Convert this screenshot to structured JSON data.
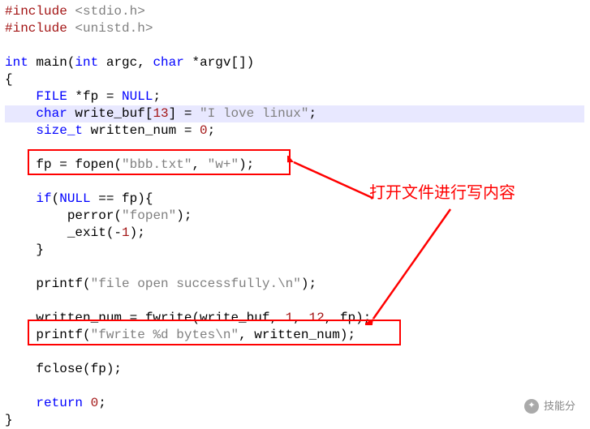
{
  "code": {
    "l1_pp": "#include",
    "l1_hdr": " <stdio.h>",
    "l2_pp": "#include",
    "l2_hdr": " <unistd.h>",
    "l4_kw1": "int",
    "l4_id1": " main(",
    "l4_kw2": "int",
    "l4_id2": " argc, ",
    "l4_kw3": "char",
    "l4_id3": " *argv[])",
    "l5": "{",
    "l6_sp": "    ",
    "l6_kw": "FILE",
    "l6_id": " *fp = ",
    "l6_kw2": "NULL",
    "l6_sc": ";",
    "l7_sp": "    ",
    "l7_kw": "char",
    "l7_id": " write_buf[",
    "l7_num": "13",
    "l7_id2": "] = ",
    "l7_str": "\"I love linux\"",
    "l7_sc": ";",
    "l8_sp": "    ",
    "l8_kw": "size_t",
    "l8_id": " written_num = ",
    "l8_num": "0",
    "l8_sc": ";",
    "l10_sp": "    ",
    "l10_id": "fp = fopen(",
    "l10_str": "\"bbb.txt\"",
    "l10_c": ", ",
    "l10_str2": "\"w+\"",
    "l10_sc": ");",
    "l12_sp": "    ",
    "l12_kw": "if",
    "l12_id": "(",
    "l12_kw2": "NULL",
    "l12_id2": " == fp){",
    "l13_sp": "        ",
    "l13_id": "perror(",
    "l13_str": "\"fopen\"",
    "l13_sc": ");",
    "l14_sp": "        ",
    "l14_id": "_exit(-",
    "l14_num": "1",
    "l14_sc": ");",
    "l15_sp": "    ",
    "l15_id": "}",
    "l17_sp": "    ",
    "l17_id": "printf(",
    "l17_str": "\"file open successfully.\\n\"",
    "l17_sc": ");",
    "l19_sp": "    ",
    "l19_id": "written_num = fwrite(write_buf, ",
    "l19_n1": "1",
    "l19_c": ", ",
    "l19_n2": "12",
    "l19_sc": ", fp);",
    "l20_sp": "    ",
    "l20_id": "printf(",
    "l20_str": "\"fwrite %d bytes\\n\"",
    "l20_id2": ", written_num);",
    "l22_sp": "    ",
    "l22_id": "fclose(fp);",
    "l24_sp": "    ",
    "l24_kw": "return",
    "l24_sp2": " ",
    "l24_num": "0",
    "l24_sc": ";",
    "l25": "}"
  },
  "callout_text": "打开文件进行写内容",
  "watermark": "技能分"
}
